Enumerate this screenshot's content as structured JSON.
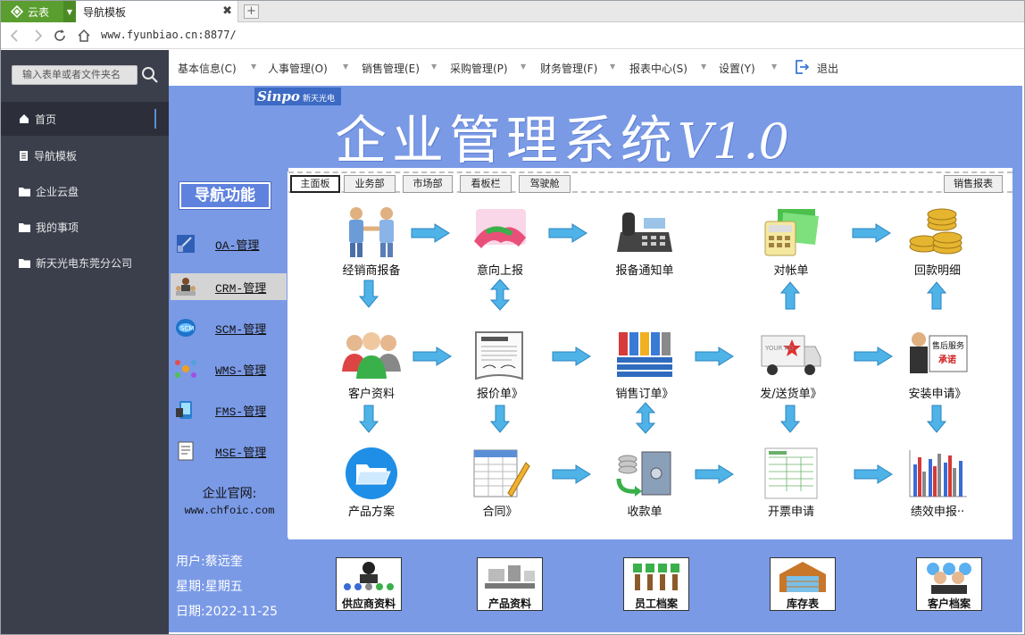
{
  "browser": {
    "brand": "云表",
    "tab_title": "导航模板",
    "url": "www.fyunbiao.cn:8877/"
  },
  "sidebar": {
    "search_placeholder": "输入表单或者文件夹名",
    "items": [
      {
        "label": "首页",
        "icon": "home-icon"
      },
      {
        "label": "导航模板",
        "icon": "document-icon"
      },
      {
        "label": "企业云盘",
        "icon": "folder-icon"
      },
      {
        "label": "我的事项",
        "icon": "folder-icon"
      },
      {
        "label": "新天光电东莞分公司",
        "icon": "folder-icon"
      }
    ]
  },
  "menu": {
    "items": [
      "基本信息(C)",
      "人事管理(O)",
      "销售管理(E)",
      "采购管理(P)",
      "财务管理(F)",
      "报表中心(S)",
      "设置(Y)"
    ],
    "logout": "退出"
  },
  "banner": {
    "logo": "Sinpo",
    "logo_sub": "新天光电",
    "title": "企业管理系统",
    "version": "V1.0"
  },
  "leftnav": {
    "title": "导航功能",
    "items": [
      "OA-管理",
      "CRM-管理",
      "SCM-管理",
      "WMS-管理",
      "FMS-管理",
      "MSE-管理"
    ],
    "selected": "CRM-管理",
    "site_label": "企业官网:",
    "site_url": "www.chfoic.com"
  },
  "user": {
    "user": "用户:蔡远奎",
    "week": "星期:星期五",
    "date": "日期:2022-11-25"
  },
  "tabs": {
    "items": [
      "主面板",
      "业务部",
      "市场部",
      "看板栏",
      "驾驶舱"
    ],
    "active": "主面板",
    "right": "销售报表"
  },
  "flow": {
    "nodes": [
      "经销商报备",
      "意向上报",
      "报备通知单",
      "对帐单",
      "回款明细",
      "客户资料",
      "报价单》",
      "销售订单》",
      "发/送货单》",
      "安装申请》",
      "产品方案",
      "合同》",
      "收款单",
      "开票申请",
      "绩效申报··"
    ]
  },
  "bottom": {
    "tiles": [
      "供应商资料",
      "产品资料",
      "员工档案",
      "库存表",
      "客户档案"
    ]
  },
  "colors": {
    "sidebar": "#3b3f4c",
    "content": "#7a9ae6",
    "arrow": "#4fb3e8",
    "brand": "#5a9e2f"
  }
}
